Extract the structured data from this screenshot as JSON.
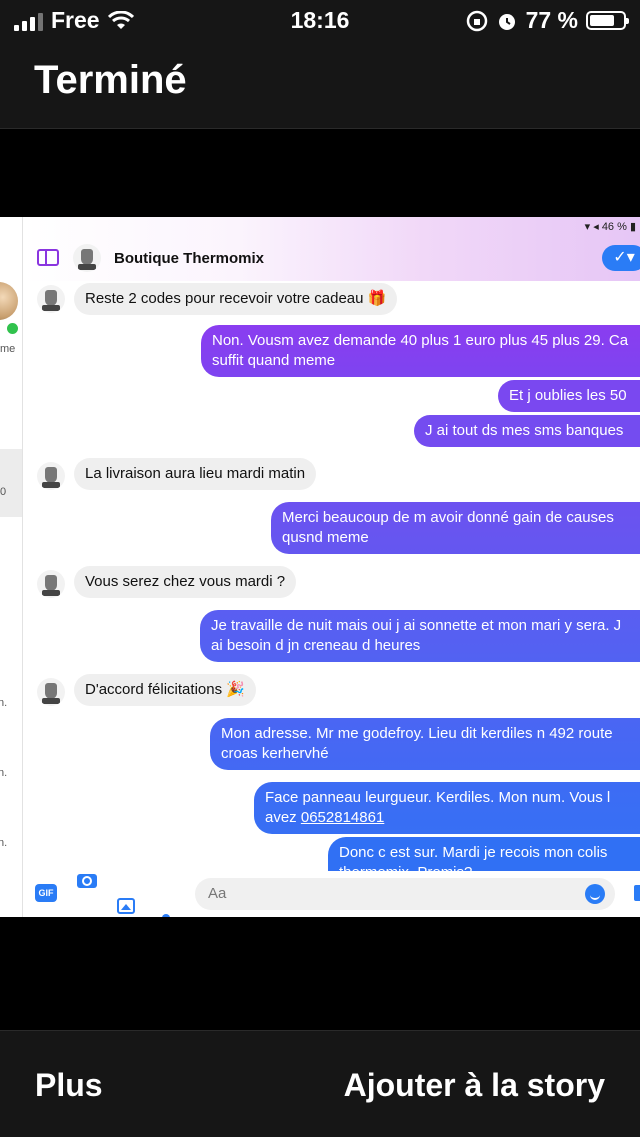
{
  "status_bar": {
    "carrier": "Free",
    "time": "18:16",
    "battery_percent": "77 %",
    "battery_level": 0.77,
    "icons": [
      "signal-icon",
      "wifi-icon",
      "orientation-lock-icon",
      "alarm-icon",
      "battery-icon"
    ]
  },
  "top_bar": {
    "done_label": "Terminé"
  },
  "screenshot": {
    "mini_status": "46 %",
    "conversation": {
      "title": "Boutique Thermomix"
    },
    "sidebar_fragments": [
      "me",
      "0",
      "n.",
      "n.",
      "n."
    ],
    "messages": [
      {
        "dir": "in",
        "text": "Reste 2 codes pour recevoir votre cadeau 🎁"
      },
      {
        "dir": "out",
        "text": "Non. Vousm avez demande 40 plus 1 euro plus 45 plus 29. Ca suffit quand meme"
      },
      {
        "dir": "out",
        "text": "Et j oublies les 50"
      },
      {
        "dir": "out",
        "text": "J ai tout ds mes sms banques"
      },
      {
        "dir": "in",
        "text": "La livraison aura lieu mardi matin"
      },
      {
        "dir": "out",
        "text": "Merci beaucoup de m avoir donné gain de causes qusnd meme"
      },
      {
        "dir": "in",
        "text": "Vous serez chez vous mardi ?"
      },
      {
        "dir": "out",
        "text": "Je travaille de nuit mais oui j ai sonnette et mon mari y sera. J ai besoin d jn creneau d heures"
      },
      {
        "dir": "in",
        "text": "D'accord félicitations 🎉"
      },
      {
        "dir": "out",
        "text": "Mon adresse.   Mr me godefroy.     Lieu dit kerdiles n  492 route croas kerhervhé"
      },
      {
        "dir": "out",
        "text_before": "Face panneau leurgueur. Kerdiles.  Mon num.  Vous l avez  ",
        "link": "0652814861"
      },
      {
        "dir": "out",
        "text": "Donc c est sur.  Mardi je recois  mon colis thermomix. Promis?"
      }
    ],
    "composer": {
      "placeholder": "Aa",
      "gif_label": "GIF"
    }
  },
  "bottom_bar": {
    "more_label": "Plus",
    "add_story_label": "Ajouter à la story"
  },
  "colors": {
    "bubble_top": "#8a3df0",
    "bubble_bottom": "#2f6cf4",
    "incoming_bubble": "#efefef",
    "accent": "#2a7cf6"
  }
}
